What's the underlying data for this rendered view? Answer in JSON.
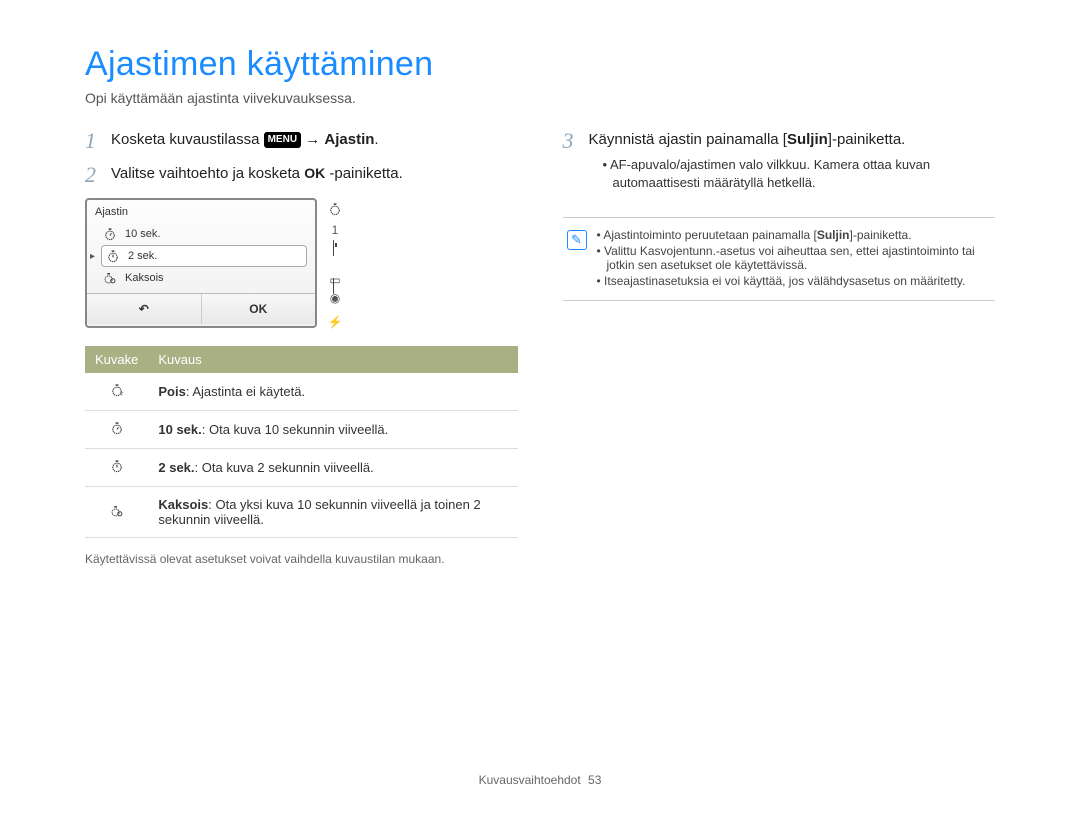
{
  "title": "Ajastimen käyttäminen",
  "subtitle": "Opi käyttämään ajastinta viivekuvauksessa.",
  "left": {
    "step1_pre": "Kosketa kuvaustilassa",
    "step1_menu": "MENU",
    "step1_arrow": "→",
    "step1_post": "Ajastin",
    "step1_end": ".",
    "step2_pre": "Valitse vaihtoehto ja kosketa",
    "step2_ok": "OK",
    "step2_post": "-painiketta.",
    "camera": {
      "header": "Ajastin",
      "opts": [
        "10 sek.",
        "2 sek.",
        "Kaksois"
      ],
      "count": "1",
      "back": "↶",
      "ok": "OK"
    },
    "table": {
      "head1": "Kuvake",
      "head2": "Kuvaus",
      "rows": [
        {
          "b": "Pois",
          "t": ": Ajastinta ei käytetä."
        },
        {
          "b": "10 sek.",
          "t": ": Ota kuva 10 sekunnin viiveellä."
        },
        {
          "b": "2 sek.",
          "t": ": Ota kuva 2 sekunnin viiveellä."
        },
        {
          "b": "Kaksois",
          "t": ": Ota yksi kuva 10 sekunnin viiveellä ja toinen 2 sekunnin viiveellä."
        }
      ]
    },
    "note": "Käytettävissä olevat asetukset voivat vaihdella kuvaustilan mukaan."
  },
  "right": {
    "step3_pre": "Käynnistä ajastin painamalla [",
    "step3_b": "Suljin",
    "step3_post": "]-painiketta.",
    "bullet1": "AF-apuvalo/ajastimen valo vilkkuu. Kamera ottaa kuvan automaattisesti määrätyllä hetkellä.",
    "info": [
      {
        "pre": "Ajastintoiminto peruutetaan painamalla [",
        "b": "Suljin",
        "post": "]-painiketta."
      },
      {
        "pre": "Valittu Kasvojentunn.-asetus voi aiheuttaa sen, ettei ajastintoiminto tai jotkin sen asetukset ole käytettävissä.",
        "b": "",
        "post": ""
      },
      {
        "pre": "Itseajastinasetuksia ei voi käyttää, jos välähdysasetus on määritetty.",
        "b": "",
        "post": ""
      }
    ]
  },
  "footer": {
    "section": "Kuvausvaihtoehdot",
    "page": "53"
  }
}
